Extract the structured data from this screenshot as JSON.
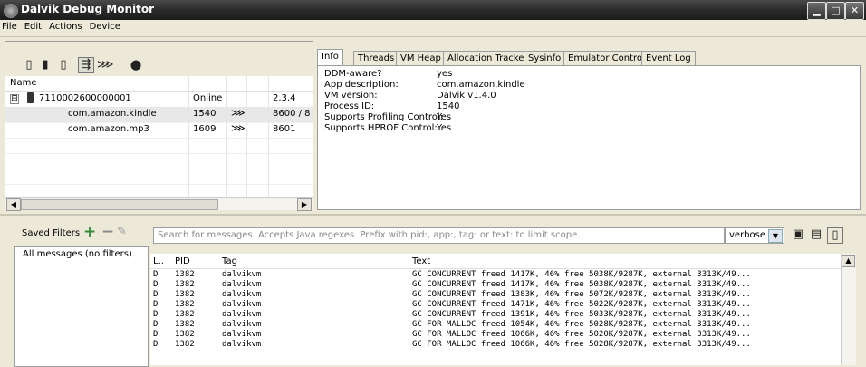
{
  "window": {
    "title": "Dalvik Debug Monitor",
    "min": "▁",
    "max": "□",
    "close": "✕"
  },
  "menu": [
    "File",
    "Edit",
    "Actions",
    "Device"
  ],
  "devices": {
    "header": {
      "name": "Name"
    },
    "device": {
      "serial": "7110002600000001",
      "status": "Online",
      "version": "2.3.4",
      "expand": "⊟"
    },
    "processes": [
      {
        "name": "com.amazon.kindle",
        "pid": "1540",
        "port": "8600 / 8",
        "selected": true
      },
      {
        "name": "com.amazon.mp3",
        "pid": "1609",
        "port": "8601",
        "selected": false
      }
    ]
  },
  "tabs": [
    "Info",
    "Threads",
    "VM Heap",
    "Allocation Tracker",
    "Sysinfo",
    "Emulator Control",
    "Event Log"
  ],
  "info": [
    {
      "key": "DDM-aware?",
      "value": "yes"
    },
    {
      "key": "App description:",
      "value": "com.amazon.kindle"
    },
    {
      "key": "VM version:",
      "value": "Dalvik v1.4.0"
    },
    {
      "key": "Process ID:",
      "value": "1540"
    },
    {
      "key": "Supports Profiling Control:",
      "value": "Yes"
    },
    {
      "key": "Supports HPROF Control:",
      "value": "Yes"
    }
  ],
  "filters": {
    "label": "Saved Filters",
    "add": "+",
    "remove": "−",
    "edit": "✎",
    "items": [
      "All messages (no filters)"
    ]
  },
  "logcat": {
    "search_placeholder": "Search for messages. Accepts Java regexes. Prefix with pid:, app:, tag: or text: to limit scope.",
    "level": "verbose",
    "columns": {
      "level": "L..",
      "pid": "PID",
      "tag": "Tag",
      "text": "Text"
    },
    "rows": [
      {
        "l": "D",
        "pid": "1382",
        "tag": "dalvikvm",
        "text": "GC CONCURRENT freed 1417K, 46% free 5038K/9287K, external 3313K/49..."
      },
      {
        "l": "D",
        "pid": "1382",
        "tag": "dalvikvm",
        "text": "GC CONCURRENT freed 1417K, 46% free 5038K/9287K, external 3313K/49..."
      },
      {
        "l": "D",
        "pid": "1382",
        "tag": "dalvikvm",
        "text": "GC CONCURRENT freed 1383K, 46% free 5072K/9287K, external 3313K/49..."
      },
      {
        "l": "D",
        "pid": "1382",
        "tag": "dalvikvm",
        "text": "GC CONCURRENT freed 1471K, 46% free 5022K/9287K, external 3313K/49..."
      },
      {
        "l": "D",
        "pid": "1382",
        "tag": "dalvikvm",
        "text": "GC CONCURRENT freed 1391K, 46% free 5033K/9287K, external 3313K/49..."
      },
      {
        "l": "D",
        "pid": "1382",
        "tag": "dalvikvm",
        "text": "GC FOR MALLOC freed 1054K, 46% free 5028K/9287K, external 3313K/49..."
      },
      {
        "l": "D",
        "pid": "1382",
        "tag": "dalvikvm",
        "text": "GC FOR MALLOC freed 1066K, 46% free 5020K/9287K, external 3313K/49..."
      },
      {
        "l": "D",
        "pid": "1382",
        "tag": "dalvikvm",
        "text": "GC FOR MALLOC freed 1066K, 46% free 5028K/9287K, external 3313K/49..."
      }
    ]
  }
}
